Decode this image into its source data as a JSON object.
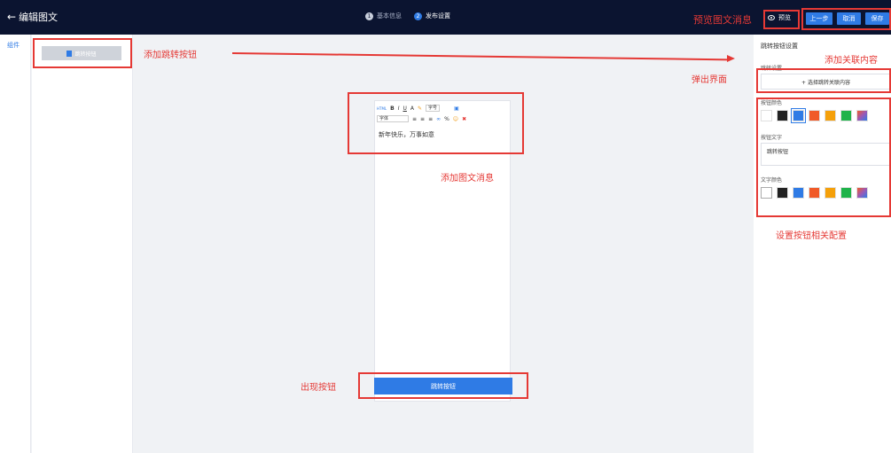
{
  "header": {
    "back_label": "编辑图文",
    "steps": [
      {
        "num": "1",
        "label": "基本信息",
        "active": false
      },
      {
        "num": "2",
        "label": "发布设置",
        "active": true
      }
    ],
    "preview_label": "预览",
    "prev_label": "上一步",
    "cancel_label": "取消",
    "save_label": "保存"
  },
  "left_tab": {
    "label": "组件"
  },
  "components": {
    "jump_button_label": "跳转按钮"
  },
  "editor": {
    "toolbar_row1": [
      "HTML",
      "B",
      "I",
      "U",
      "A",
      "字号"
    ],
    "toolbar_row2": [
      "字体"
    ],
    "content": "新年快乐，万事如意"
  },
  "phone": {
    "button_label": "跳转按钮"
  },
  "settings": {
    "title": "跳转按钮设置",
    "jump_setting_label": "跳转设置",
    "select_content_label": "+ 选择跳转关联内容",
    "button_color_label": "按钮颜色",
    "button_text_label": "按钮文字",
    "button_text_value": "跳转按钮",
    "text_color_label": "文字颜色",
    "swatch_colors": [
      "#ffffff",
      "#222222",
      "#2f7be5",
      "#f05a28",
      "#f5a00a",
      "#1fb34a",
      "gradient"
    ]
  },
  "annotations": {
    "preview_msg": "预览图文消息",
    "add_jump_button": "添加跳转按钮",
    "add_related_content": "添加关联内容",
    "popup_interface": "弹出界面",
    "add_article_msg": "添加图文消息",
    "set_button_config": "设置按钮相关配置",
    "button_appears": "出现按钮"
  }
}
